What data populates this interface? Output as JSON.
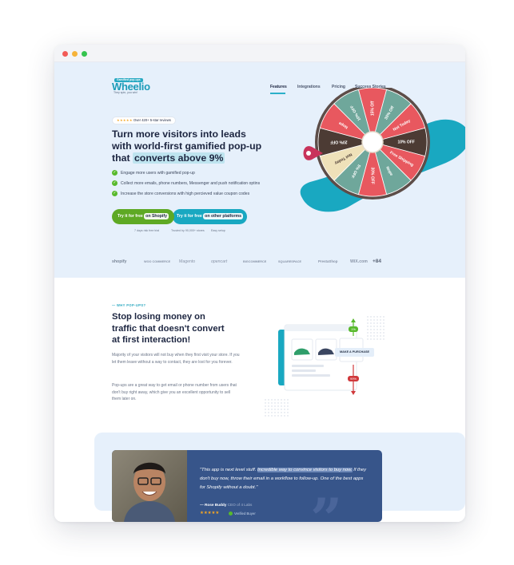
{
  "brand": {
    "name": "Wheelio",
    "badge": "Gamified pop-ups",
    "tagline": "They spin, you win!"
  },
  "nav": [
    {
      "label": "Features",
      "active": true
    },
    {
      "label": "Integrations"
    },
    {
      "label": "Pricing"
    },
    {
      "label": "Success Stories"
    }
  ],
  "hero": {
    "rating_stars": "★★★★★",
    "rating_text": "Over 420+ 5-star reviews",
    "headline_1": "Turn more visitors into leads",
    "headline_2": "with world-first gamified pop-up",
    "headline_3": "that",
    "headline_highlight": "converts above 9%",
    "features": [
      "Engage more users with gamified pop-up",
      "Collect more emails, phone numbers, Messenger and push notification optins",
      "Increase the store conversions with high percieved value coupon codes"
    ],
    "cta_shopify_prefix": "Try it for free",
    "cta_shopify_pill": "on Shopify",
    "cta_other_prefix": "Try it for free",
    "cta_other_pill": "on other platforms",
    "trust": [
      "7 days risk free trial",
      "Trusted by 90,000+ stores",
      "Easy setup"
    ],
    "platforms": [
      "shopify",
      "WOO COMMERCE",
      "Magento",
      "opencart",
      "BIGCOMMERCE",
      "SQUARESPACE",
      "PrestaShop",
      "WiX.com",
      "+84"
    ]
  },
  "wheel": {
    "segments": [
      "15% Off",
      "30% Off",
      "Not Today",
      "10% OFF",
      "Free Shipping",
      "Nope",
      "30% OFF",
      "5% OFF",
      "Not Today",
      "20% OFF",
      "Nope",
      "10% OFF"
    ],
    "colors": {
      "red": "#e8585f",
      "teal": "#6fa79b",
      "cream": "#efe1b9",
      "dark": "#4c3b34",
      "rim": "#5d4d48",
      "pointer": "#c8335b",
      "blob": "#19a8c1"
    }
  },
  "why": {
    "kicker": "— WHY POP-UPS?",
    "title": "Stop losing money on traffic that doesn't convert at first interaction!",
    "para_1": "Majority of your visitors will not buy when they first visit your store. If you let them leave without a way to contact, they are lost for you forever.",
    "para_2": "Pop-ups are a great way to get email or phone number from users that don't buy right away, which give you an excellent opportunity to sell them later on.",
    "tag_purchase": "MAKE A PURCHASE",
    "tag_leave": "LEAVE WITHOUT A PURCHASE",
    "pct_up": "1%",
    "pct_down": "99%"
  },
  "testimonial": {
    "quote_1": "\"This app is next level stuff.",
    "quote_highlight": "Incredible way to convince visitors to buy now.",
    "quote_2": "If they don't buy now, throw their email in a workflow to follow-up. One of the best apps for Shopify without a doubt.\"",
    "author": "— Rose Buddy",
    "role": "CEO of 4 Labs",
    "stars": "★★★★★",
    "verified": "Verified Buyer"
  },
  "accent": "#19a8c1"
}
